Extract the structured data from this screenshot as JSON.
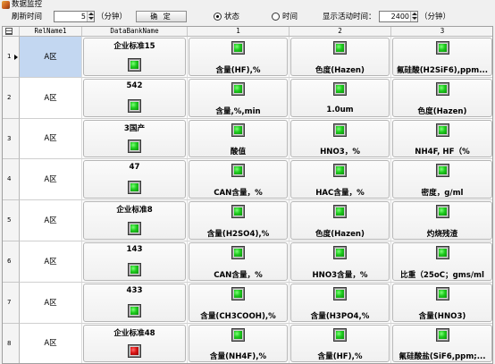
{
  "window": {
    "title": "数据监控"
  },
  "toolbar": {
    "refresh_label": "刷新时间",
    "refresh_value": "5",
    "refresh_unit": "（分钟）",
    "confirm_label": "确 定",
    "status_radio_label": "状态",
    "time_radio_label": "时间",
    "active_time_label": "显示活动时间：",
    "active_time_value": "2400",
    "active_time_unit": "（分钟）",
    "selected_mode": "状态"
  },
  "grid": {
    "columns": [
      "RelName1",
      "DataBankName",
      "1",
      "2",
      "3"
    ],
    "rows": [
      {
        "num": "1",
        "rel": "A区",
        "bank": "企业标准15",
        "bank_status": "green",
        "items": [
          {
            "label": "含量(HF),%",
            "status": "green"
          },
          {
            "label": "色度(Hazen)",
            "status": "green"
          },
          {
            "label": "氟硅酸(H2SiF6),ppm...",
            "status": "green"
          }
        ]
      },
      {
        "num": "2",
        "rel": "A区",
        "bank": "542",
        "bank_status": "green",
        "items": [
          {
            "label": "含量,%,min",
            "status": "green"
          },
          {
            "label": "1.0um",
            "status": "green"
          },
          {
            "label": "色度(Hazen)",
            "status": "green"
          }
        ]
      },
      {
        "num": "3",
        "rel": "A区",
        "bank": "3国产",
        "bank_status": "green",
        "items": [
          {
            "label": "酸值",
            "status": "green"
          },
          {
            "label": "HNO3，%",
            "status": "green"
          },
          {
            "label": "NH4F, HF（%",
            "status": "green"
          }
        ]
      },
      {
        "num": "4",
        "rel": "A区",
        "bank": "47",
        "bank_status": "green",
        "items": [
          {
            "label": "CAN含量，%",
            "status": "green"
          },
          {
            "label": "HAC含量，%",
            "status": "green"
          },
          {
            "label": "密度，g/ml",
            "status": "green"
          }
        ]
      },
      {
        "num": "5",
        "rel": "A区",
        "bank": "企业标准8",
        "bank_status": "green",
        "items": [
          {
            "label": "含量(H2SO4),%",
            "status": "green"
          },
          {
            "label": "色度(Hazen)",
            "status": "green"
          },
          {
            "label": "灼烧残渣",
            "status": "green"
          }
        ]
      },
      {
        "num": "6",
        "rel": "A区",
        "bank": "143",
        "bank_status": "green",
        "items": [
          {
            "label": "CAN含量，%",
            "status": "green"
          },
          {
            "label": "HNO3含量，%",
            "status": "green"
          },
          {
            "label": "比重（25oC；gms/ml",
            "status": "green"
          }
        ]
      },
      {
        "num": "7",
        "rel": "A区",
        "bank": "433",
        "bank_status": "green",
        "items": [
          {
            "label": "含量(CH3COOH),%",
            "status": "green"
          },
          {
            "label": "含量(H3PO4,%",
            "status": "green"
          },
          {
            "label": "含量(HNO3)",
            "status": "green"
          }
        ]
      },
      {
        "num": "8",
        "rel": "A区",
        "bank": "企业标准48",
        "bank_status": "red",
        "items": [
          {
            "label": "含量(NH4F),%",
            "status": "green"
          },
          {
            "label": "含量(HF),%",
            "status": "green"
          },
          {
            "label": "氟硅酸盐(SiF6,ppm;...",
            "status": "green"
          }
        ]
      }
    ]
  },
  "colors": {
    "lamp_green": "#1ecb1e",
    "lamp_red": "#d81414",
    "selected_row": "#c3d7f1"
  }
}
